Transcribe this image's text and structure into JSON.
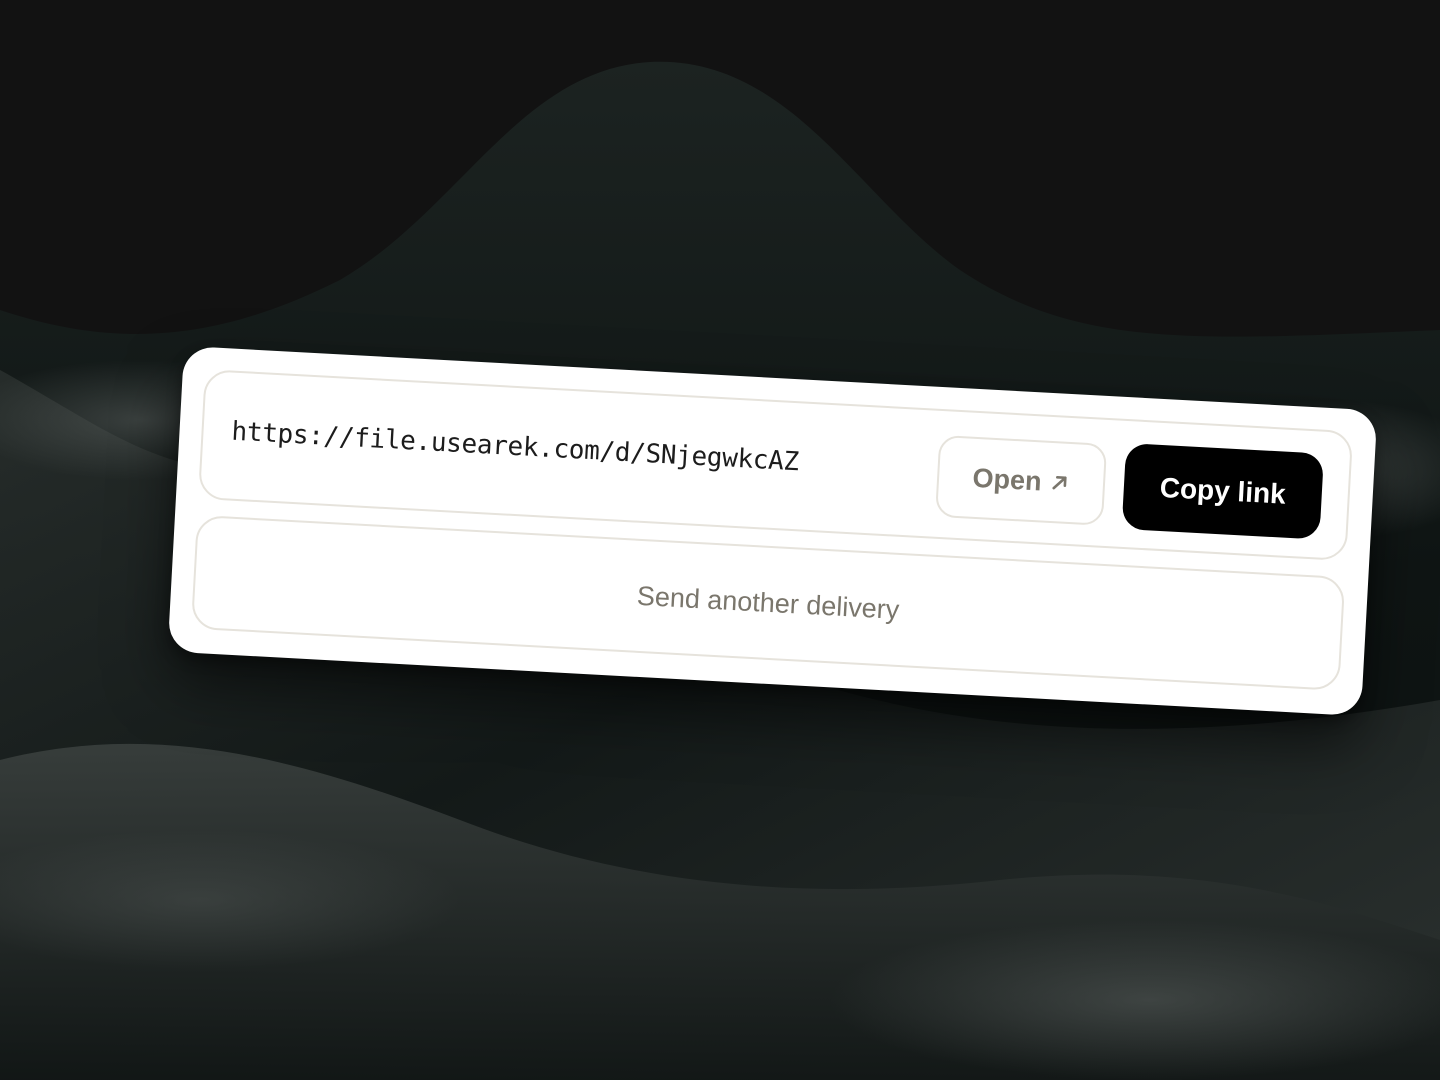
{
  "delivery": {
    "url": "https://file.usearek.com/d/SNjegwkcAZ"
  },
  "actions": {
    "open_label": "Open",
    "open_icon": "arrow-up-right-icon",
    "copy_label": "Copy link",
    "another_label": "Send another delivery"
  },
  "colors": {
    "background": "#121212",
    "card": "#ffffff",
    "border": "#e6e3dc",
    "muted_text": "#7a766c",
    "primary_button": "#000000",
    "primary_text": "#ffffff"
  }
}
